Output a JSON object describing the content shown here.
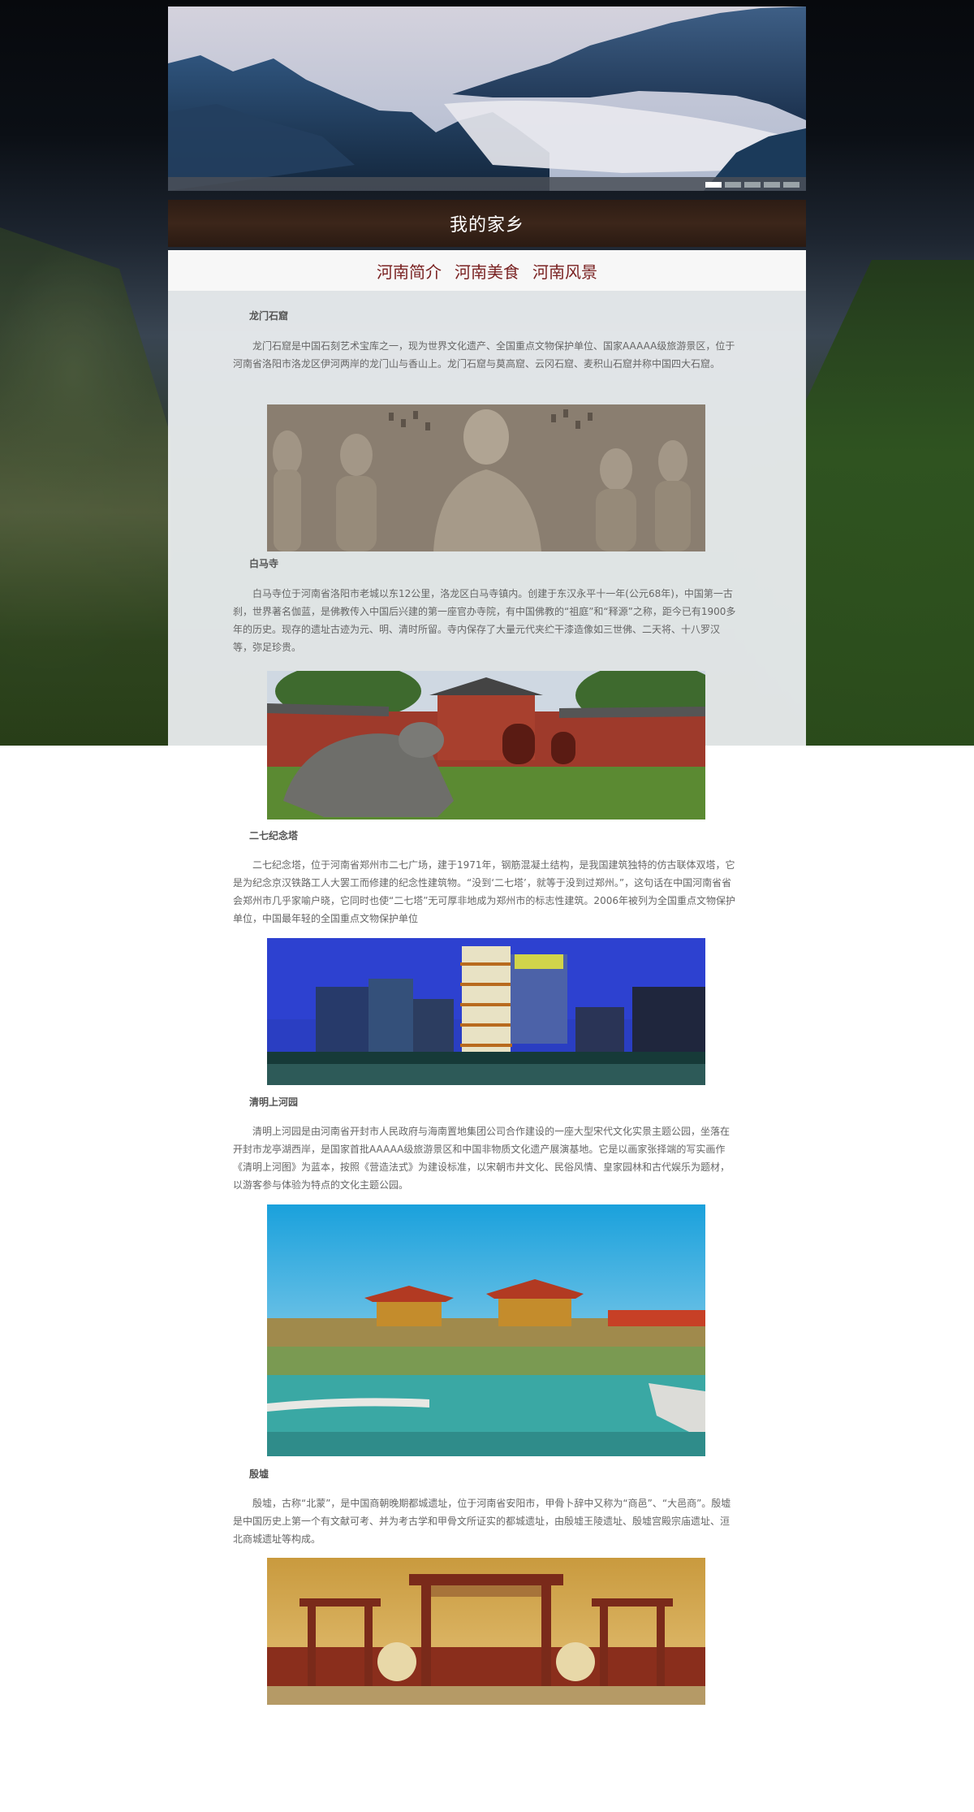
{
  "banner": {
    "slides": [
      1,
      2,
      3,
      4,
      5
    ],
    "active_slide": 1
  },
  "header": {
    "title": "我的家乡"
  },
  "nav": {
    "items": [
      {
        "label": "河南简介"
      },
      {
        "label": "河南美食"
      },
      {
        "label": "河南风景"
      }
    ]
  },
  "sections": [
    {
      "heading": "龙门石窟",
      "body": "龙门石窟是中国石刻艺术宝库之一，现为世界文化遗产、全国重点文物保护单位、国家AAAAA级旅游景区，位于河南省洛阳市洛龙区伊河两岸的龙门山与香山上。龙门石窟与莫高窟、云冈石窟、麦积山石窟并称中国四大石窟。"
    },
    {
      "heading": "白马寺",
      "body": "白马寺位于河南省洛阳市老城以东12公里，洛龙区白马寺镇内。创建于东汉永平十一年(公元68年)，中国第一古刹，世界著名伽蓝，是佛教传入中国后兴建的第一座官办寺院，有中国佛教的“祖庭”和“释源”之称，距今已有1900多年的历史。现存的遗址古迹为元、明、清时所留。寺内保存了大量元代夹纻干漆造像如三世佛、二天将、十八罗汉等，弥足珍贵。"
    },
    {
      "heading": "二七纪念塔",
      "body": "二七纪念塔，位于河南省郑州市二七广场，建于1971年，钢筋混凝土结构，是我国建筑独特的仿古联体双塔，它是为纪念京汉铁路工人大罢工而修建的纪念性建筑物。“没到‘二七塔’，就等于没到过郑州。”，这句话在中国河南省省会郑州市几乎家喻户晓，它同时也使“二七塔”无可厚非地成为郑州市的标志性建筑。2006年被列为全国重点文物保护单位，中国最年轻的全国重点文物保护单位"
    },
    {
      "heading": "清明上河园",
      "body": "清明上河园是由河南省开封市人民政府与海南置地集团公司合作建设的一座大型宋代文化实景主题公园，坐落在开封市龙亭湖西岸，是国家首批AAAAA级旅游景区和中国非物质文化遗产展演基地。它是以画家张择端的写实画作《清明上河图》为蓝本，按照《营造法式》为建设标准，以宋朝市井文化、民俗风情、皇家园林和古代娱乐为题材，以游客参与体验为特点的文化主题公园。"
    },
    {
      "heading": "殷墟",
      "body": "殷墟，古称“北蒙”，是中国商朝晚期都城遗址，位于河南省安阳市，甲骨卜辞中又称为“商邑”、“大邑商”。殷墟是中国历史上第一个有文献可考、并为考古学和甲骨文所证实的都城遗址，由殷墟王陵遗址、殷墟宫殿宗庙遗址、洹北商城遗址等构成。"
    }
  ]
}
